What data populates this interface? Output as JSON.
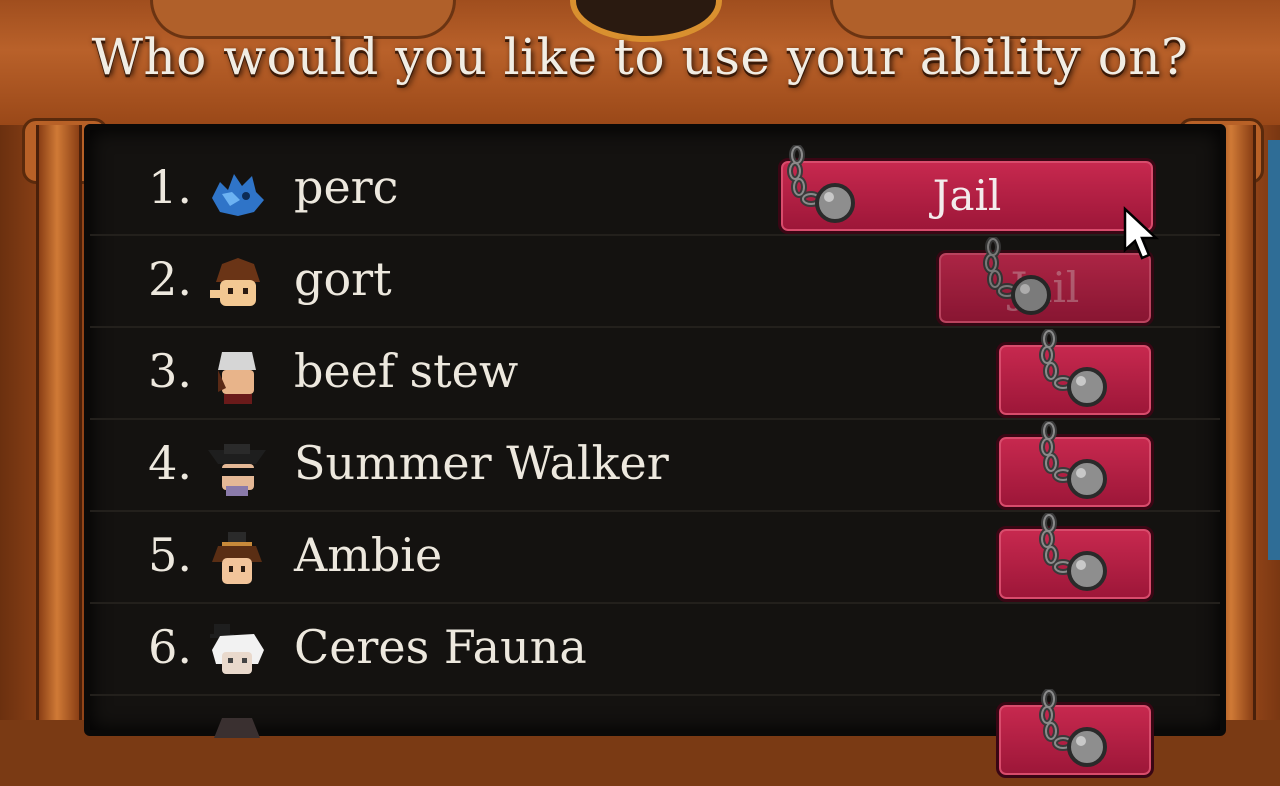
{
  "prompt": {
    "title": "Who would you like to use your ability on?"
  },
  "players": [
    {
      "number": "1.",
      "name": "perc",
      "avatar": "blue-creature-avatar",
      "action": "Jail",
      "button_state": "hovered"
    },
    {
      "number": "2.",
      "name": "gort",
      "avatar": "brown-hair-avatar",
      "action": "Jail",
      "button_state": "faded"
    },
    {
      "number": "3.",
      "name": "beef stew",
      "avatar": "white-hat-avatar",
      "action": "",
      "button_state": "icon-only"
    },
    {
      "number": "4.",
      "name": "Summer Walker",
      "avatar": "black-hat-sunglasses-avatar",
      "action": "",
      "button_state": "icon-only"
    },
    {
      "number": "5.",
      "name": "Ambie",
      "avatar": "top-hat-avatar",
      "action": "",
      "button_state": "icon-only"
    },
    {
      "number": "6.",
      "name": "Ceres Fauna",
      "avatar": "white-hair-top-hat-avatar",
      "action": "",
      "button_state": "none"
    }
  ],
  "colors": {
    "button": "#b0203f",
    "panel": "#141210",
    "frame": "#a04e1e",
    "text": "#ede8de"
  }
}
